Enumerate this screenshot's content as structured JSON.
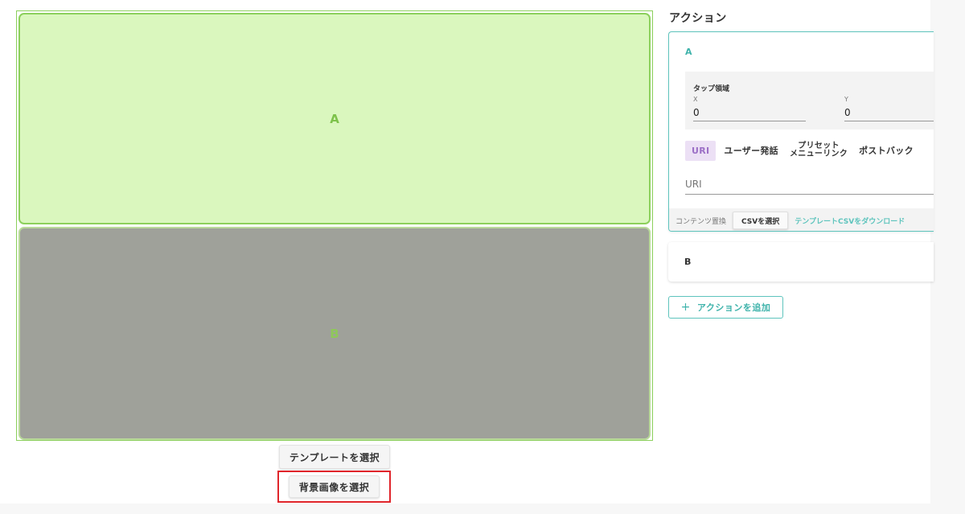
{
  "canvas": {
    "areas": [
      {
        "label": "A"
      },
      {
        "label": "B"
      }
    ]
  },
  "buttons": {
    "select_template": "テンプレートを選択",
    "select_background": "背景画像を選択"
  },
  "actions": {
    "title": "アクション",
    "items": [
      {
        "label": "A",
        "tap_area": {
          "title": "タップ領域",
          "x_label": "X",
          "x_value": "0",
          "y_label": "Y",
          "y_value": "0"
        },
        "types": [
          "URI",
          "ユーザー発話",
          "プリセット\nメニューリンク",
          "ポストバック"
        ],
        "selected_type": "URI",
        "uri_placeholder": "URI",
        "content_replace_label": "コンテンツ置換",
        "csv_button": "CSVを選択",
        "download_link": "テンプレートCSVをダウンロード"
      },
      {
        "label": "B"
      }
    ],
    "add_button": "アクションを追加"
  },
  "colors": {
    "accent": "#5ec4bd",
    "area_green": "#daf7be",
    "area_border": "#8cd05c",
    "area_gray": "#9fa19a",
    "uri_chip": "#ece0f5",
    "highlight": "#e0252b"
  }
}
